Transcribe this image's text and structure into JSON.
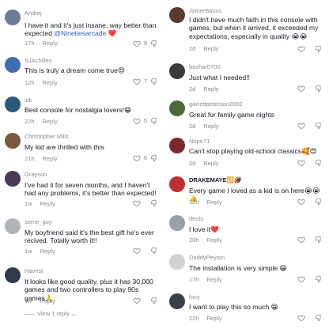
{
  "left": [
    {
      "user": "Andrej",
      "text": "I have it and it's just insane, way better than expected",
      "mention": "@Ninetiesarcade",
      "emoji": "❤️",
      "time": "17h",
      "reply": "Reply",
      "likes": "9",
      "avatar_color": "#6b7c9a"
    },
    {
      "user": "SJAchilles",
      "text": "This is truly a dream come true😍",
      "time": "12h",
      "reply": "Reply",
      "likes": "7",
      "avatar_color": "#3d6fb0"
    },
    {
      "user": "ldk",
      "text": "Best console for nostalgia lovers!😁",
      "time": "22h",
      "reply": "Reply",
      "likes": "5",
      "avatar_color": "#2d5a7a"
    },
    {
      "user": "Christopher Mills",
      "text": "My kid are thrilled with this",
      "time": "21h",
      "reply": "Reply",
      "likes": "6",
      "avatar_color": "#7a5a3a"
    },
    {
      "user": "Grayson",
      "text": "I've had it for seven months, and I haven't had any problems, it's better than expected!",
      "time": "1w",
      "reply": "Reply",
      "likes": "",
      "avatar_color": "#4a3a5a"
    },
    {
      "user": "some_guy",
      "text": "My boyfriend said it's the best gift he's ever recived. Totally worth it!!",
      "time": "1w",
      "reply": "Reply",
      "likes": "",
      "avatar_color": "#b0b3b8"
    },
    {
      "user": "Havrist",
      "text": "It looks like good quality, plus it has 30,000 games and two controllers to play 90s games🙏",
      "time": "1w",
      "reply": "Reply",
      "likes": "",
      "avatar_color": "#2f3a4a"
    }
  ],
  "view_reply": "View 1 reply",
  "right": [
    {
      "user": "JymerBacus",
      "text": "I didn't have much faith in this console with games, but when it arrived, it exceeded my expectations, especially in quality 😭😭",
      "time": "2d",
      "reply": "Reply",
      "likes": "",
      "avatar_color": "#5a3a2a"
    },
    {
      "user": "bashar0700",
      "text": "Just what I needed!!",
      "time": "2d",
      "reply": "Reply",
      "likes": "",
      "avatar_color": "#3a3a3a"
    },
    {
      "user": "garrettpeterson2002",
      "text": "Great for family game nights",
      "time": "2d",
      "reply": "Reply",
      "likes": "",
      "avatar_color": "#4a6a3a"
    },
    {
      "user": "Nope71",
      "text": "Can't stop playing old-school classics🥰😍",
      "time": "2d",
      "reply": "Reply",
      "likes": "",
      "avatar_color": "#7a2a2a"
    },
    {
      "user": "DRAKEMAYE🔁🏈",
      "text": "Every game I loved as a kid is on here😭😭👍",
      "time": "12h",
      "reply": "Reply",
      "likes": "",
      "avatar_color": "#c03030"
    },
    {
      "user": "denis",
      "text": "I love it❤️",
      "time": "20h",
      "reply": "Reply",
      "likes": "",
      "avatar_color": "#9aa0a8"
    },
    {
      "user": "DaddyPeyton",
      "text": "The installation is very simple 😁",
      "time": "17h",
      "reply": "Reply",
      "likes": "",
      "avatar_color": "#d0d2d6"
    },
    {
      "user": "foxy",
      "text": "I want to play this so much 😁",
      "time": "22h",
      "reply": "Reply",
      "likes": "",
      "avatar_color": "#3a3f4a"
    }
  ]
}
